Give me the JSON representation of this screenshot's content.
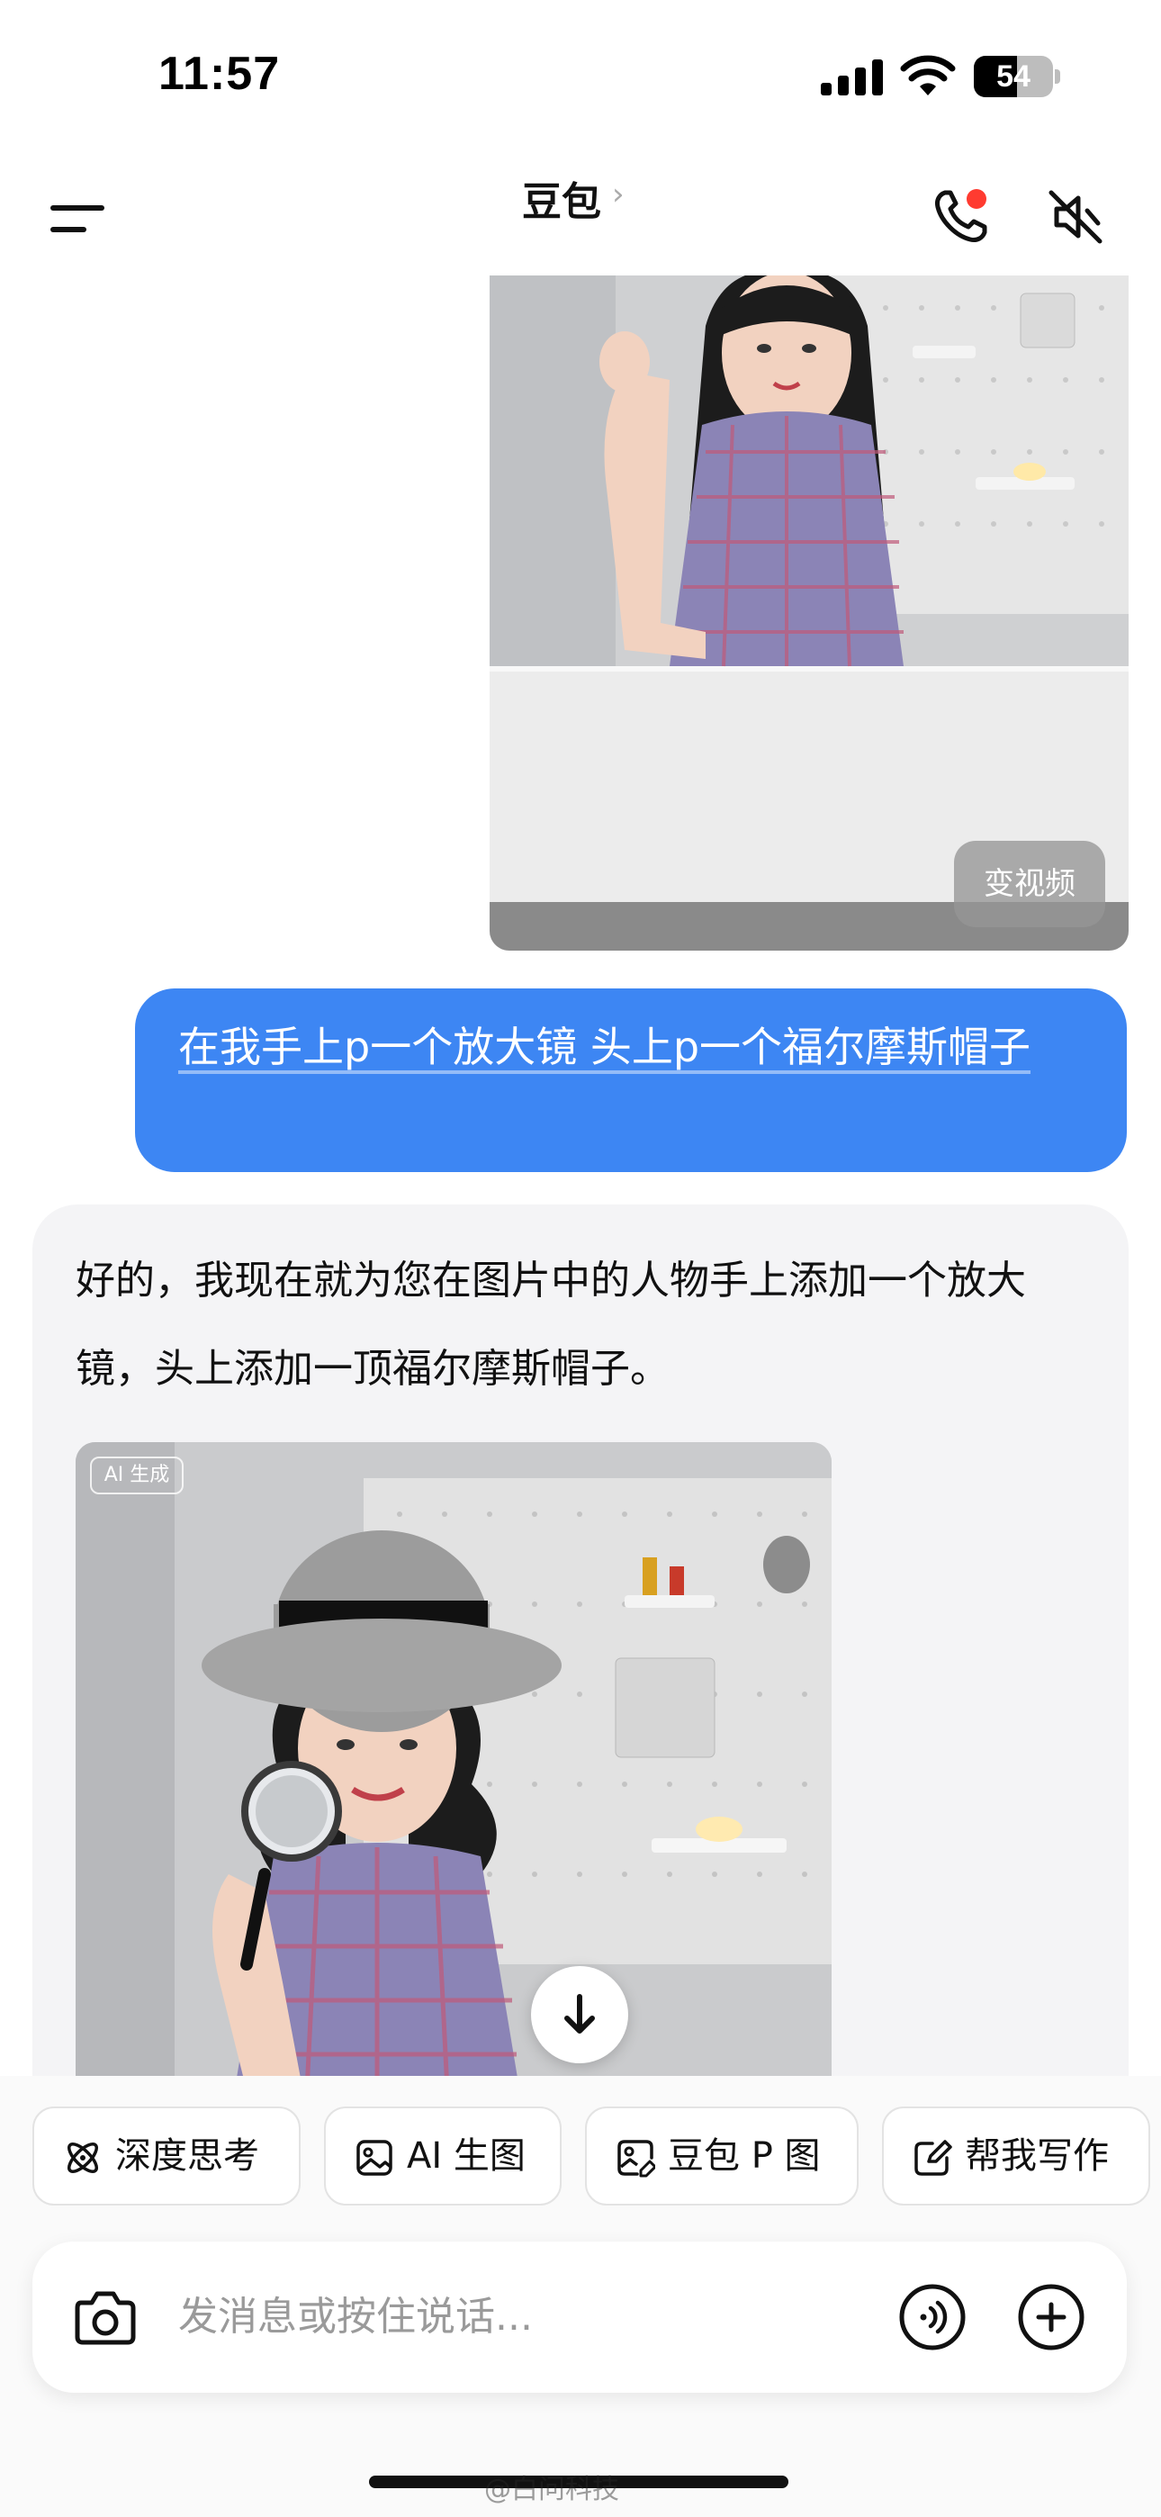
{
  "status_bar": {
    "time": "11:57",
    "battery_level": "54",
    "battery_fraction": 0.54,
    "icons": [
      "signal-icon",
      "wifi-icon",
      "battery-icon"
    ]
  },
  "header": {
    "title": "豆包",
    "title_chevron": "›",
    "menu_icon": "menu-icon",
    "call_icon": "phone-icon",
    "call_indicator_color": "#ff3b30",
    "mute_icon": "speaker-mute-icon"
  },
  "chat": {
    "user_image": {
      "description_icon": "photo",
      "action_label": "变视频"
    },
    "user_message": "在我手上p一个放大镜 头上p一个福尔摩斯帽子",
    "bot_message": "好的，我现在就为您在图片中的人物手上添加一个放大镜，头上添加一顶福尔摩斯帽子。",
    "bot_image": {
      "badge": "AI 生成"
    },
    "scroll_down_icon": "arrow-down-icon"
  },
  "quick_actions": [
    {
      "label": "深度思考",
      "icon": "atom-icon"
    },
    {
      "label": "AI 生图",
      "icon": "image-icon"
    },
    {
      "label": "豆包 P 图",
      "icon": "image-edit-icon"
    },
    {
      "label": "帮我写作",
      "icon": "pen-square-icon"
    }
  ],
  "input": {
    "placeholder": "发消息或按住说话...",
    "camera_icon": "camera-icon",
    "voice_icon": "voice-wave-icon",
    "plus_icon": "plus-circle-icon"
  },
  "watermark": "@白问科技",
  "colors": {
    "accent_blue": "#3d86f3",
    "bot_bubble": "#f4f4f6",
    "chip_border": "#e3e3e3"
  }
}
